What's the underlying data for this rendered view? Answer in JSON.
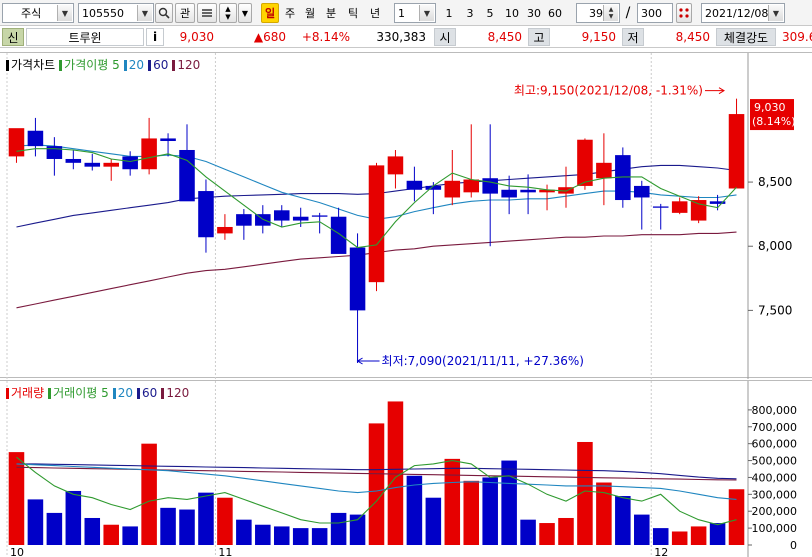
{
  "toolbar": {
    "market_select": "주식",
    "stock_code": "105550",
    "search_icon": "search-icon",
    "fav_label": "관",
    "period_buttons": [
      "일",
      "주",
      "월",
      "분",
      "틱",
      "년"
    ],
    "active_period": "일",
    "interval_value": "1",
    "interval_buttons": [
      "1",
      "3",
      "5",
      "10",
      "30",
      "60"
    ],
    "display_count": "39",
    "separator": "/",
    "total_count": "300",
    "date": "2021/12/08"
  },
  "info": {
    "credit_label": "신",
    "name": "트루윈",
    "info_icon": "i",
    "price": "9,030",
    "change": "▲680",
    "change_rate": "+8.14%",
    "volume": "330,383",
    "open_label": "시",
    "open": "8,450",
    "high_label": "고",
    "high": "9,150",
    "low_label": "저",
    "low": "8,450",
    "strength_label": "체결강도",
    "strength": "309.6"
  },
  "colors": {
    "up": "#e60000",
    "down": "#0000c8",
    "ma5": "#2f9a2f",
    "ma20": "#1f86c0",
    "ma60": "#1a1a8c",
    "ma120": "#7a1a3e"
  },
  "chart_data": [
    {
      "type": "candlestick",
      "legend": [
        {
          "label": "가격차트",
          "color": "#000000"
        },
        {
          "label": "가격이평 5",
          "color": "#2f9a2f"
        },
        {
          "label": "20",
          "color": "#1f86c0"
        },
        {
          "label": "60",
          "color": "#1a1a8c"
        },
        {
          "label": "120",
          "color": "#7a1a3e"
        }
      ],
      "ylim": [
        7090,
        9350
      ],
      "y_ticks": [
        7500,
        8000,
        8500
      ],
      "y_tick_labels": [
        "7,500",
        "8,000",
        "8,500"
      ],
      "x_tick_labels": [
        {
          "index": 0,
          "label": "10"
        },
        {
          "index": 11,
          "label": "11"
        },
        {
          "index": 34,
          "label": "12"
        }
      ],
      "current_label": [
        "9,030",
        "(8.14%)"
      ],
      "high_annotation": "최고:9,150(2021/12/08, -1.31%)",
      "low_annotation": "최저:7,090(2021/11/11, +27.36%)",
      "candles": [
        {
          "o": 8700,
          "h": 8900,
          "l": 8650,
          "c": 8920
        },
        {
          "o": 8900,
          "h": 9000,
          "l": 8700,
          "c": 8780
        },
        {
          "o": 8780,
          "h": 8850,
          "l": 8550,
          "c": 8680
        },
        {
          "o": 8680,
          "h": 8750,
          "l": 8600,
          "c": 8650
        },
        {
          "o": 8650,
          "h": 8720,
          "l": 8590,
          "c": 8620
        },
        {
          "o": 8620,
          "h": 8680,
          "l": 8510,
          "c": 8650
        },
        {
          "o": 8700,
          "h": 8740,
          "l": 8550,
          "c": 8600
        },
        {
          "o": 8600,
          "h": 9000,
          "l": 8560,
          "c": 8840
        },
        {
          "o": 8840,
          "h": 8880,
          "l": 8700,
          "c": 8820
        },
        {
          "o": 8750,
          "h": 8950,
          "l": 8500,
          "c": 8350
        },
        {
          "o": 8430,
          "h": 8520,
          "l": 7950,
          "c": 8070
        },
        {
          "o": 8100,
          "h": 8250,
          "l": 8050,
          "c": 8150
        },
        {
          "o": 8250,
          "h": 8290,
          "l": 8050,
          "c": 8160
        },
        {
          "o": 8250,
          "h": 8320,
          "l": 8100,
          "c": 8160
        },
        {
          "o": 8280,
          "h": 8320,
          "l": 8150,
          "c": 8200
        },
        {
          "o": 8230,
          "h": 8300,
          "l": 8150,
          "c": 8200
        },
        {
          "o": 8240,
          "h": 8260,
          "l": 8100,
          "c": 8230
        },
        {
          "o": 8230,
          "h": 8300,
          "l": 7950,
          "c": 7940
        },
        {
          "o": 7990,
          "h": 8100,
          "l": 7090,
          "c": 7500
        },
        {
          "o": 7720,
          "h": 8650,
          "l": 7650,
          "c": 8630
        },
        {
          "o": 8560,
          "h": 8750,
          "l": 8450,
          "c": 8700
        },
        {
          "o": 8510,
          "h": 8620,
          "l": 8350,
          "c": 8440
        },
        {
          "o": 8470,
          "h": 8500,
          "l": 8250,
          "c": 8440
        },
        {
          "o": 8380,
          "h": 8750,
          "l": 8320,
          "c": 8510
        },
        {
          "o": 8420,
          "h": 8950,
          "l": 8380,
          "c": 8520
        },
        {
          "o": 8530,
          "h": 8950,
          "l": 8000,
          "c": 8410
        },
        {
          "o": 8440,
          "h": 8550,
          "l": 8250,
          "c": 8380
        },
        {
          "o": 8440,
          "h": 8560,
          "l": 8250,
          "c": 8420
        },
        {
          "o": 8420,
          "h": 8480,
          "l": 8280,
          "c": 8440
        },
        {
          "o": 8410,
          "h": 8620,
          "l": 8300,
          "c": 8460
        },
        {
          "o": 8470,
          "h": 8840,
          "l": 8440,
          "c": 8830
        },
        {
          "o": 8530,
          "h": 8880,
          "l": 8320,
          "c": 8650
        },
        {
          "o": 8710,
          "h": 8770,
          "l": 8300,
          "c": 8360
        },
        {
          "o": 8470,
          "h": 8510,
          "l": 8130,
          "c": 8380
        },
        {
          "o": 8310,
          "h": 8330,
          "l": 8130,
          "c": 8300
        },
        {
          "o": 8260,
          "h": 8380,
          "l": 8250,
          "c": 8350
        },
        {
          "o": 8200,
          "h": 8390,
          "l": 8180,
          "c": 8360
        },
        {
          "o": 8350,
          "h": 8400,
          "l": 8280,
          "c": 8330
        },
        {
          "o": 8450,
          "h": 9150,
          "l": 8450,
          "c": 9030
        }
      ],
      "ma5": [
        8740,
        8760,
        8760,
        8750,
        8730,
        8680,
        8660,
        8690,
        8720,
        8670,
        8540,
        8430,
        8320,
        8210,
        8150,
        8180,
        8190,
        8100,
        7990,
        8010,
        8190,
        8340,
        8470,
        8570,
        8520,
        8500,
        8470,
        8460,
        8440,
        8430,
        8500,
        8530,
        8540,
        8540,
        8450,
        8390,
        8330,
        8300,
        8460
      ],
      "ma20": [
        8780,
        8790,
        8780,
        8760,
        8740,
        8720,
        8700,
        8700,
        8710,
        8700,
        8660,
        8600,
        8540,
        8480,
        8420,
        8380,
        8340,
        8290,
        8240,
        8210,
        8230,
        8270,
        8300,
        8330,
        8350,
        8360,
        8360,
        8370,
        8370,
        8390,
        8410,
        8430,
        8430,
        8420,
        8400,
        8390,
        8380,
        8380,
        8400
      ],
      "ma60": [
        8150,
        8180,
        8210,
        8240,
        8260,
        8280,
        8300,
        8320,
        8340,
        8370,
        8380,
        8390,
        8395,
        8400,
        8405,
        8410,
        8410,
        8410,
        8405,
        8410,
        8430,
        8450,
        8470,
        8490,
        8500,
        8510,
        8520,
        8530,
        8540,
        8550,
        8560,
        8580,
        8600,
        8620,
        8630,
        8630,
        8620,
        8610,
        8590
      ],
      "ma120": [
        7520,
        7550,
        7580,
        7610,
        7640,
        7670,
        7700,
        7730,
        7760,
        7790,
        7810,
        7820,
        7840,
        7860,
        7880,
        7900,
        7910,
        7920,
        7930,
        7950,
        7970,
        7980,
        8000,
        8010,
        8020,
        8030,
        8040,
        8050,
        8060,
        8070,
        8070,
        8080,
        8080,
        8090,
        8090,
        8090,
        8100,
        8100,
        8110
      ]
    },
    {
      "type": "bar",
      "legend": [
        {
          "label": "거래량",
          "color": "#e60000"
        },
        {
          "label": "거래이평 5",
          "color": "#2f9a2f"
        },
        {
          "label": "20",
          "color": "#1f86c0"
        },
        {
          "label": "60",
          "color": "#1a1a8c"
        },
        {
          "label": "120",
          "color": "#7a1a3e"
        }
      ],
      "ylim": [
        0,
        900000
      ],
      "y_ticks": [
        0,
        100000,
        200000,
        300000,
        400000,
        500000,
        600000,
        700000,
        800000
      ],
      "y_tick_labels": [
        "0",
        "100,000",
        "200,000",
        "300,000",
        "400,000",
        "500,000",
        "600,000",
        "700,000",
        "800,000"
      ],
      "volumes": [
        550000,
        270000,
        190000,
        320000,
        160000,
        120000,
        110000,
        600000,
        220000,
        210000,
        310000,
        280000,
        150000,
        120000,
        110000,
        100000,
        100000,
        190000,
        180000,
        720000,
        850000,
        410000,
        280000,
        510000,
        380000,
        400000,
        500000,
        150000,
        130000,
        160000,
        610000,
        370000,
        290000,
        180000,
        100000,
        80000,
        110000,
        130000,
        330000
      ],
      "vol_ma5": [
        520000,
        430000,
        350000,
        300000,
        280000,
        240000,
        210000,
        260000,
        280000,
        270000,
        290000,
        310000,
        270000,
        230000,
        190000,
        150000,
        130000,
        130000,
        150000,
        260000,
        400000,
        470000,
        480000,
        500000,
        480000,
        400000,
        410000,
        360000,
        300000,
        260000,
        320000,
        310000,
        280000,
        260000,
        300000,
        200000,
        150000,
        120000,
        150000
      ],
      "vol_ma20": [
        480000,
        475000,
        470000,
        465000,
        460000,
        455000,
        450000,
        445000,
        440000,
        430000,
        420000,
        410000,
        395000,
        380000,
        365000,
        350000,
        335000,
        320000,
        310000,
        320000,
        340000,
        355000,
        365000,
        370000,
        375000,
        370000,
        365000,
        360000,
        355000,
        350000,
        350000,
        350000,
        345000,
        340000,
        335000,
        320000,
        300000,
        280000,
        270000
      ],
      "vol_ma60": [
        480000,
        480000,
        478000,
        476000,
        474000,
        472000,
        470000,
        468000,
        466000,
        464000,
        462000,
        460000,
        458000,
        456000,
        454000,
        452000,
        450000,
        448000,
        446000,
        446000,
        448000,
        450000,
        452000,
        454000,
        454000,
        452000,
        450000,
        448000,
        446000,
        444000,
        442000,
        440000,
        436000,
        430000,
        422000,
        412000,
        402000,
        395000,
        392000
      ],
      "vol_ma120": [
        460000,
        458000,
        456000,
        454000,
        452000,
        450000,
        448000,
        446000,
        444000,
        442000,
        440000,
        438000,
        436000,
        434000,
        432000,
        430000,
        428000,
        426000,
        424000,
        422000,
        420000,
        418000,
        416000,
        414000,
        412000,
        410000,
        408000,
        406000,
        404000,
        402000,
        400000,
        398000,
        396000,
        394000,
        392000,
        390000,
        388000,
        386000,
        385000
      ]
    }
  ]
}
